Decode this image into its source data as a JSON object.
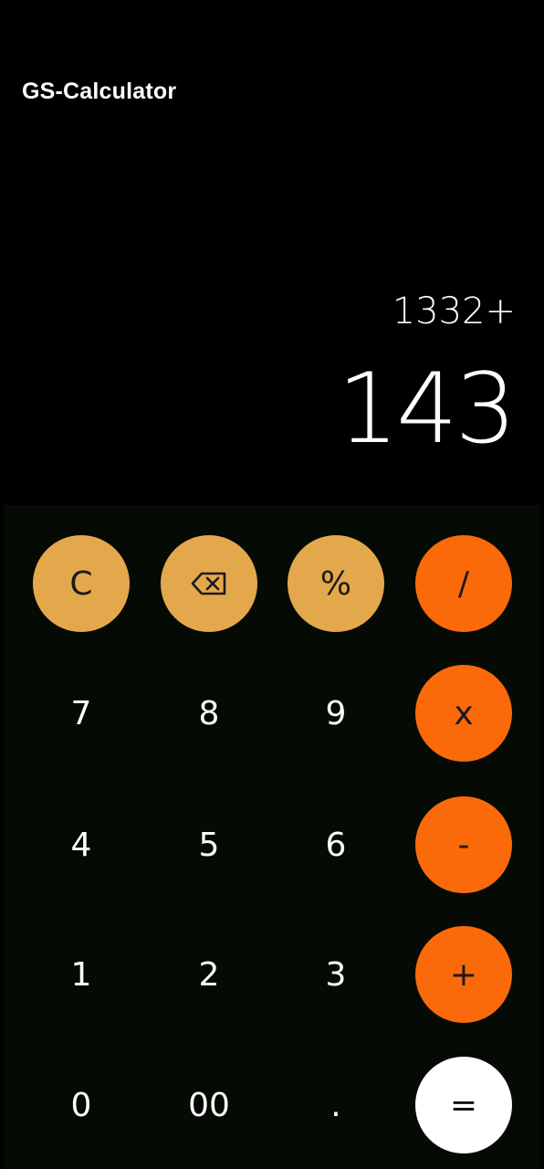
{
  "app": {
    "title": "GS-Calculator"
  },
  "display": {
    "expression": "1332+",
    "result": "143"
  },
  "keypad": {
    "row1": {
      "clear": "C",
      "backspace_icon": "backspace-icon",
      "percent": "%",
      "divide": "/"
    },
    "row2": {
      "seven": "7",
      "eight": "8",
      "nine": "9",
      "multiply": "x"
    },
    "row3": {
      "four": "4",
      "five": "5",
      "six": "6",
      "subtract": "-"
    },
    "row4": {
      "one": "1",
      "two": "2",
      "three": "3",
      "add": "+"
    },
    "row5": {
      "zero": "0",
      "double_zero": "00",
      "decimal": ".",
      "equals": "="
    }
  },
  "colors": {
    "background": "#000000",
    "keypad_background": "#050a05",
    "function_key": "#e4a84c",
    "operator_key": "#fa6a0a",
    "equals_key": "#ffffff",
    "text": "#ffffff"
  }
}
